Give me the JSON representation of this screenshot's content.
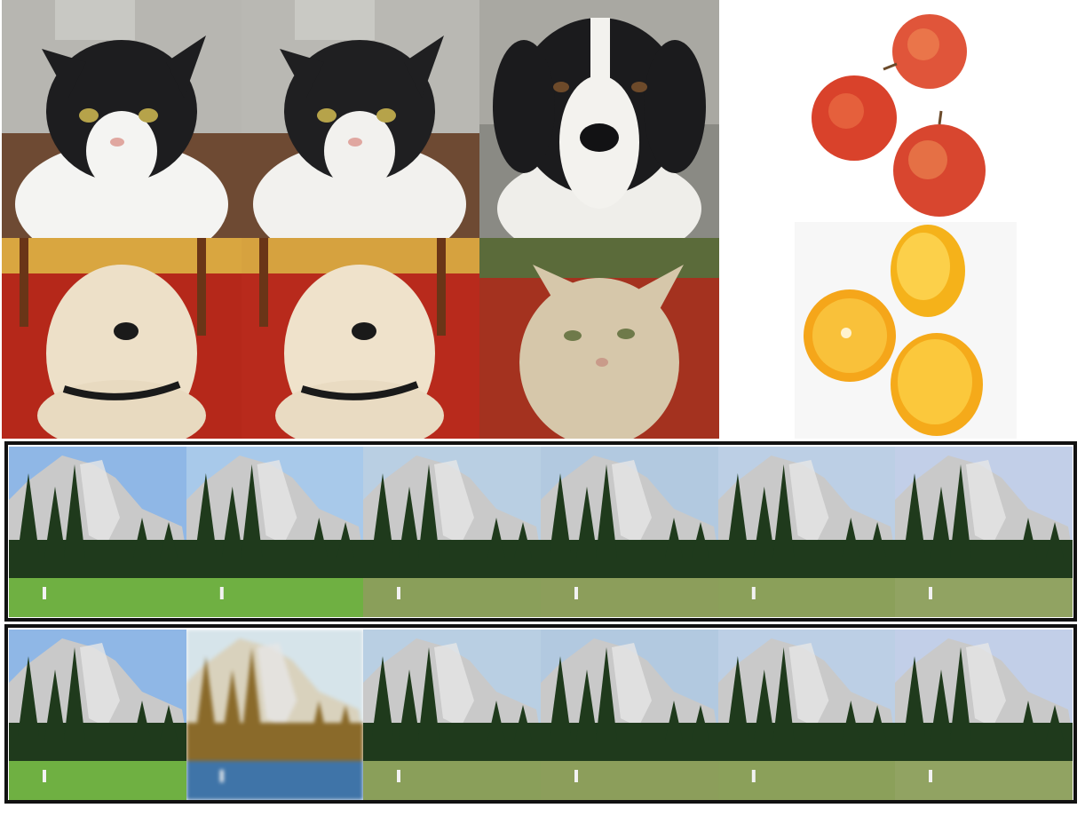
{
  "figure": {
    "animal_grid": {
      "rows": [
        {
          "row_subject": "cat",
          "tiles": [
            "cat-input",
            "cat-reconstruction",
            "cat-to-dog"
          ]
        },
        {
          "row_subject": "dog",
          "tiles": [
            "dog-input",
            "dog-reconstruction",
            "dog-to-cat"
          ]
        }
      ]
    },
    "fruit_column": {
      "tiles": [
        "apples",
        "oranges"
      ]
    },
    "landscape_panels": [
      {
        "panel": "top",
        "tiles": 6
      },
      {
        "panel": "bottom",
        "tiles": 6,
        "blurred_tile_index": 1
      }
    ],
    "colors": {
      "panel_border": "#111111",
      "sky": "#9fc4e8",
      "rock": "#c9c9c9",
      "trees": "#1f3a1c",
      "meadow": "#6fa640",
      "dog_bg": "#b5281a",
      "cat_bg": "#8a8a84",
      "apple": "#d9422b",
      "orange": "#f5b21a"
    }
  }
}
